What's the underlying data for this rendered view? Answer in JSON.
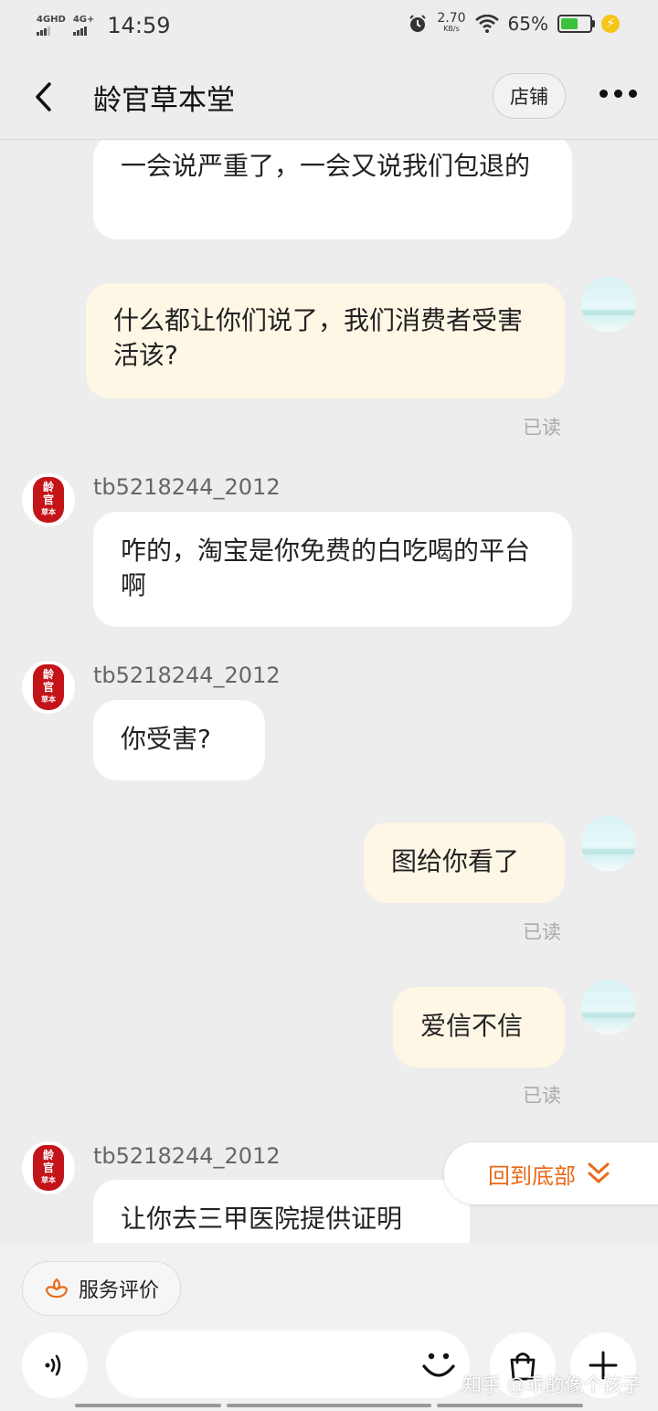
{
  "status": {
    "network1": "4GHD",
    "network2": "4G+",
    "time": "14:59",
    "speed_value": "2.70",
    "speed_unit": "KB/s",
    "battery_pct": "65%",
    "battery_level": 0.65
  },
  "header": {
    "title": "龄官草本堂",
    "shop_label": "店铺"
  },
  "messages": {
    "m1": "一会说严重了，一会又说我们包退的",
    "m2": "什么都让你们说了，我们消费者受害活该?",
    "m2_read": "已读",
    "m3_user": "tb5218244_2012",
    "m3": "咋的，淘宝是你免费的白吃喝的平台啊",
    "m4_user": "tb5218244_2012",
    "m4": "你受害?",
    "m5": "图给你看了",
    "m5_read": "已读",
    "m6": "爱信不信",
    "m6_read": "已读",
    "m7_user": "tb5218244_2012",
    "m7": "让你去三甲医院提供证明"
  },
  "shop_avatar": {
    "line1": "龄",
    "line2": "官",
    "line3": "草本"
  },
  "back_to_bottom": "回到底部",
  "bottom": {
    "service_label": "服务评价",
    "input_value": "",
    "watermark": "知乎 @乖的像个孩子"
  },
  "colors": {
    "accent": "#e86a17",
    "outgoing_bubble": "#fff7e6",
    "incoming_bubble": "#ffffff",
    "seal_red": "#c3141a"
  },
  "icons": [
    "back-icon",
    "more-icon",
    "voice-icon",
    "emoji-icon",
    "cart-icon",
    "plus-icon",
    "chevron-down-double-icon",
    "flower-icon"
  ]
}
